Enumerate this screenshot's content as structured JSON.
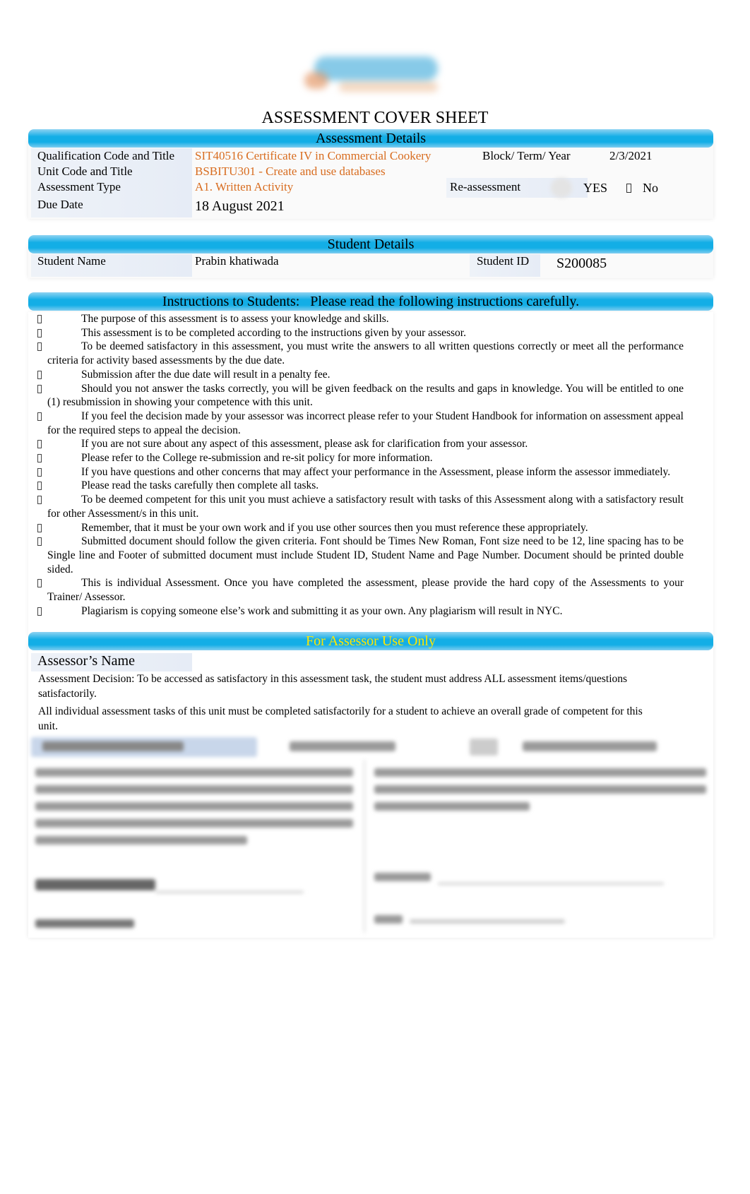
{
  "title": "ASSESSMENT COVER SHEET",
  "assessment_details": {
    "heading": "Assessment Details",
    "qualification_label": "Qualification Code and Title",
    "qualification_value": "SIT40516 Certificate IV in Commercial Cookery",
    "block_label": "Block/ Term/ Year",
    "block_value": "2/3/2021",
    "unit_label": "Unit Code and Title",
    "unit_value": "BSBITU301 - Create and use databases",
    "type_label": "Assessment Type",
    "type_value": "A1. Written Activity",
    "reassessment_label": "Re-assessment",
    "yes_label": "YES",
    "no_label": "No",
    "due_label": "Due Date",
    "due_value": "18 August 2021"
  },
  "student_details": {
    "heading": "Student Details",
    "name_label": "Student Name",
    "name_value": "Prabin khatiwada",
    "id_label": "Student ID",
    "id_value": "S200085"
  },
  "instructions": {
    "heading": "Instructions to Students:   Please read the following instructions carefully.",
    "items": [
      "The purpose of this assessment is to assess your knowledge and skills.",
      "This assessment is to be completed according to the instructions given by your assessor.",
      "To be deemed satisfactory in this assessment, you must write the answers to all written questions correctly or meet all the performance criteria for activity based assessments by the due date.",
      "Submission after the due date will result in a penalty fee.",
      "Should you not answer the tasks correctly, you will be given feedback on the results and gaps in knowledge. You will be entitled to one (1) resubmission in showing your competence with this unit.",
      "If you feel the decision made by your assessor was incorrect please refer to your Student Handbook for information on assessment appeal for the required steps to appeal the decision.",
      "If you are not sure about any aspect of this assessment, please ask for clarification from your assessor.",
      "Please refer to the College re-submission and re-sit policy for more information.",
      "If you have questions and other concerns that may affect your performance in the Assessment, please inform the assessor immediately.",
      "Please read the tasks carefully then complete all tasks.",
      "To be deemed competent for this unit you must achieve a satisfactory result with tasks of this Assessment along with a satisfactory result for other Assessment/s in this unit.",
      "Remember, that it must be your own work and if you use other sources then you must reference these appropriately.",
      "Submitted document should follow the given criteria. Font should be Times New Roman, Font size need to be 12, line spacing has to be Single line and Footer of submitted document must include Student ID, Student Name and Page Number. Document should be printed double sided.",
      "This is individual Assessment. Once you have completed the assessment, please provide the hard copy of the Assessments to your Trainer/ Assessor.",
      "Plagiarism is copying someone else’s work and submitting it as your own. Any plagiarism will result in NYC."
    ]
  },
  "assessor": {
    "heading": "For Assessor Use Only",
    "heading_color": "#ffe600",
    "name_label": "Assessor’s Name",
    "decision_text": "Assessment Decision: To be accessed as satisfactory in this assessment task, the student must address ALL assessment items/questions satisfactorily.",
    "overall_text": "All individual assessment tasks of this unit must be completed satisfactorily for a student to achieve an overall grade of competent for this unit."
  },
  "colors": {
    "bar": "#13aee6",
    "accent_text": "#d86c1f"
  }
}
